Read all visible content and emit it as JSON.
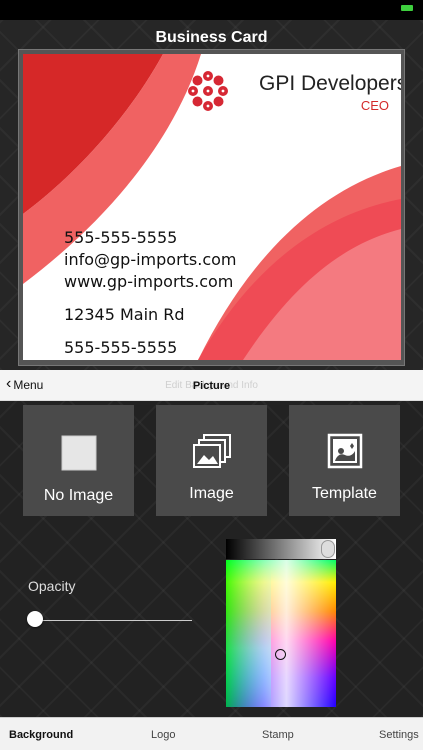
{
  "header": {
    "title": "Business Card"
  },
  "card": {
    "company": "GPI Developers",
    "role": "CEO",
    "lines": [
      "555-555-5555",
      "info@gp-imports.com",
      "www.gp-imports.com",
      "12345 Main Rd",
      "555-555-5555"
    ],
    "accent_color": "#e8202a"
  },
  "nav": {
    "back_label": "Menu",
    "ghost_label": "Edit Background Info",
    "title": "Picture"
  },
  "picture_options": [
    {
      "label": "No Image",
      "icon": "blank-square-icon"
    },
    {
      "label": "Image",
      "icon": "gallery-icon"
    },
    {
      "label": "Template",
      "icon": "template-icon"
    }
  ],
  "opacity": {
    "label": "Opacity",
    "value": 0
  },
  "color_picker": {
    "brightness": 1.0
  },
  "tabs": [
    {
      "label": "Background",
      "active": true
    },
    {
      "label": "Logo",
      "active": false
    },
    {
      "label": "Stamp",
      "active": false
    },
    {
      "label": "Settings",
      "active": false
    }
  ]
}
